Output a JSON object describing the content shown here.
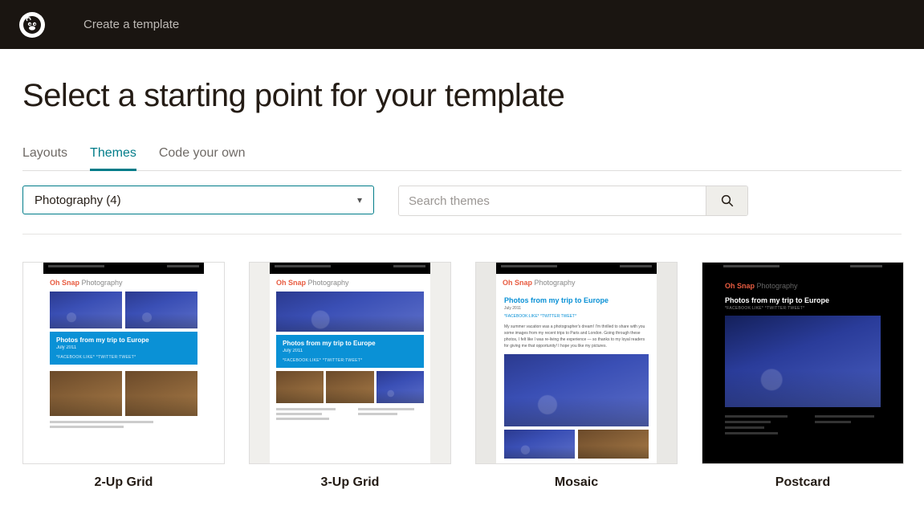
{
  "header": {
    "breadcrumb": "Create a template"
  },
  "page": {
    "title": "Select a starting point for your template"
  },
  "tabs": [
    {
      "label": "Layouts",
      "active": false
    },
    {
      "label": "Themes",
      "active": true
    },
    {
      "label": "Code your own",
      "active": false
    }
  ],
  "filter": {
    "selected": "Photography (4)"
  },
  "search": {
    "placeholder": "Search themes"
  },
  "thumb_common": {
    "brand1": "Oh Snap",
    "brand2": " Photography",
    "headline": "Photos from my trip to Europe",
    "date": "July 2011",
    "social": "*FACEBOOK:LIKE* *TWITTER:TWEET*"
  },
  "templates": [
    {
      "name": "2-Up Grid"
    },
    {
      "name": "3-Up Grid"
    },
    {
      "name": "Mosaic"
    },
    {
      "name": "Postcard"
    }
  ]
}
